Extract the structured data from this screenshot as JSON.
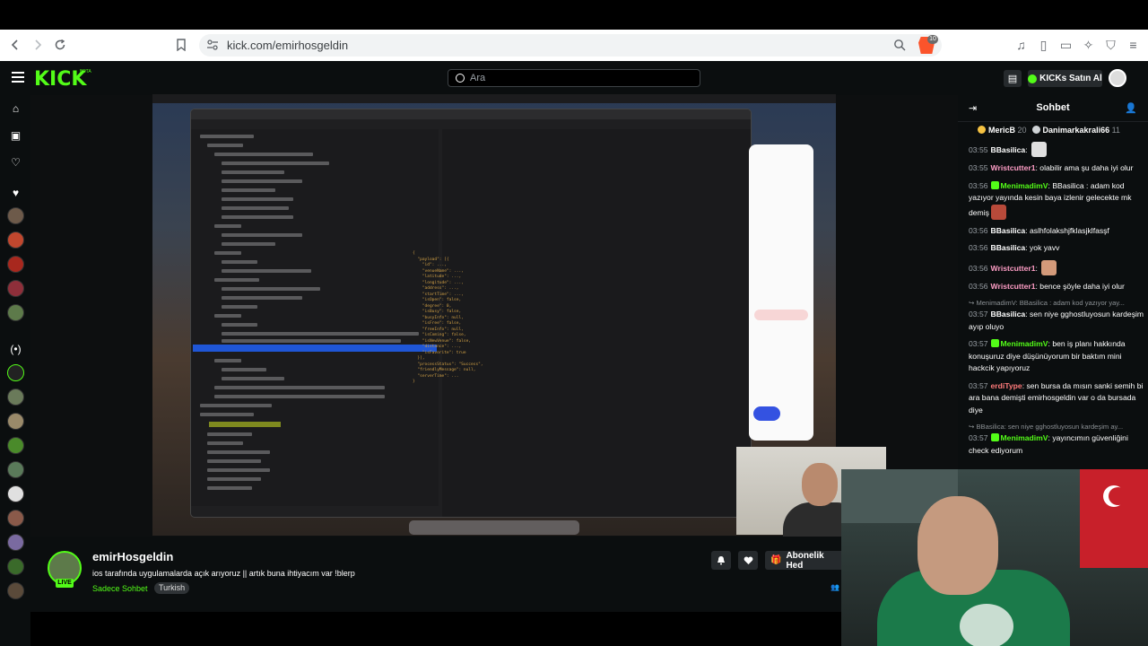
{
  "browser": {
    "url": "kick.com/emirhosgeldin",
    "brave_badge": "10"
  },
  "header": {
    "logo": "KICK",
    "logo_beta": "BETA",
    "search_placeholder": "Ara",
    "kicks_button": "KICKs Satın Al"
  },
  "colors": {
    "accent": "#53fc18",
    "background": "#0b0e0f",
    "surface": "#262a2d"
  },
  "channel": {
    "name": "emirHosgeldin",
    "live_label": "LIVE",
    "stream_title": "ios tarafında uygulamalarda açık arıyoruz || artık buna ihtiyacım var !blerp",
    "category": "Sadece Sohbet",
    "tag": "Turkish",
    "subscribe_gift_label": "Abonelik Hed"
  },
  "chat": {
    "title": "Sohbet",
    "pinned": [
      {
        "name": "MericB",
        "count": "20",
        "color": "#f5c242"
      },
      {
        "name": "Danimarkakrali66",
        "count": "11",
        "color": "#cfd3d6"
      }
    ],
    "messages": [
      {
        "type": "msg",
        "time": "03:55",
        "user": "BBasilica",
        "color": "#ffffff",
        "badge": false,
        "text": "",
        "emote": "#e0e0e0"
      },
      {
        "type": "msg",
        "time": "03:55",
        "user": "Wristcutter1",
        "color": "#ff9ec6",
        "badge": false,
        "text": "olabilir ama şu daha iyi olur"
      },
      {
        "type": "msg",
        "time": "03:56",
        "user": "MenimadimV",
        "color": "#53fc18",
        "badge": true,
        "text": "BBasilica : adam kod yazıyor yayında kesin baya izlenir gelecekte mk demiş",
        "emote_after": "#b84a3a"
      },
      {
        "type": "msg",
        "time": "03:56",
        "user": "BBasilica",
        "color": "#ffffff",
        "badge": false,
        "text": "aslhfolakshjfklasjklfasşf"
      },
      {
        "type": "msg",
        "time": "03:56",
        "user": "BBasilica",
        "color": "#ffffff",
        "badge": false,
        "text": "yok yavv"
      },
      {
        "type": "msg",
        "time": "03:56",
        "user": "Wristcutter1",
        "color": "#ff9ec6",
        "badge": false,
        "text": "",
        "emote": "#d39a7a"
      },
      {
        "type": "msg",
        "time": "03:56",
        "user": "Wristcutter1",
        "color": "#ff9ec6",
        "badge": false,
        "text": "bence şöyle daha iyi olur"
      },
      {
        "type": "reply",
        "text": "MenimadimV: BBasilica : adam kod yazıyor yay..."
      },
      {
        "type": "msg",
        "time": "03:57",
        "user": "BBasilica",
        "color": "#ffffff",
        "badge": false,
        "text": "sen niye gghostluyosun kardeşim ayıp oluyo"
      },
      {
        "type": "msg",
        "time": "03:57",
        "user": "MenimadimV",
        "color": "#53fc18",
        "badge": true,
        "text": "ben iş planı hakkında konuşuruz diye düşünüyorum bir baktım mini hackcik yapıyoruz"
      },
      {
        "type": "msg",
        "time": "03:57",
        "user": "erdiType",
        "color": "#ff7a7a",
        "badge": false,
        "text": "sen bursa da mısın sanki semih bi ara bana demişti emirhosgeldin var o da bursada diye"
      },
      {
        "type": "reply",
        "text": "BBasilica: sen niye gghostluyosun kardeşim ay..."
      },
      {
        "type": "msg",
        "time": "03:57",
        "user": "MenimadimV",
        "color": "#53fc18",
        "badge": true,
        "text": "yayıncımın güvenliğini check ediyorum"
      }
    ]
  }
}
